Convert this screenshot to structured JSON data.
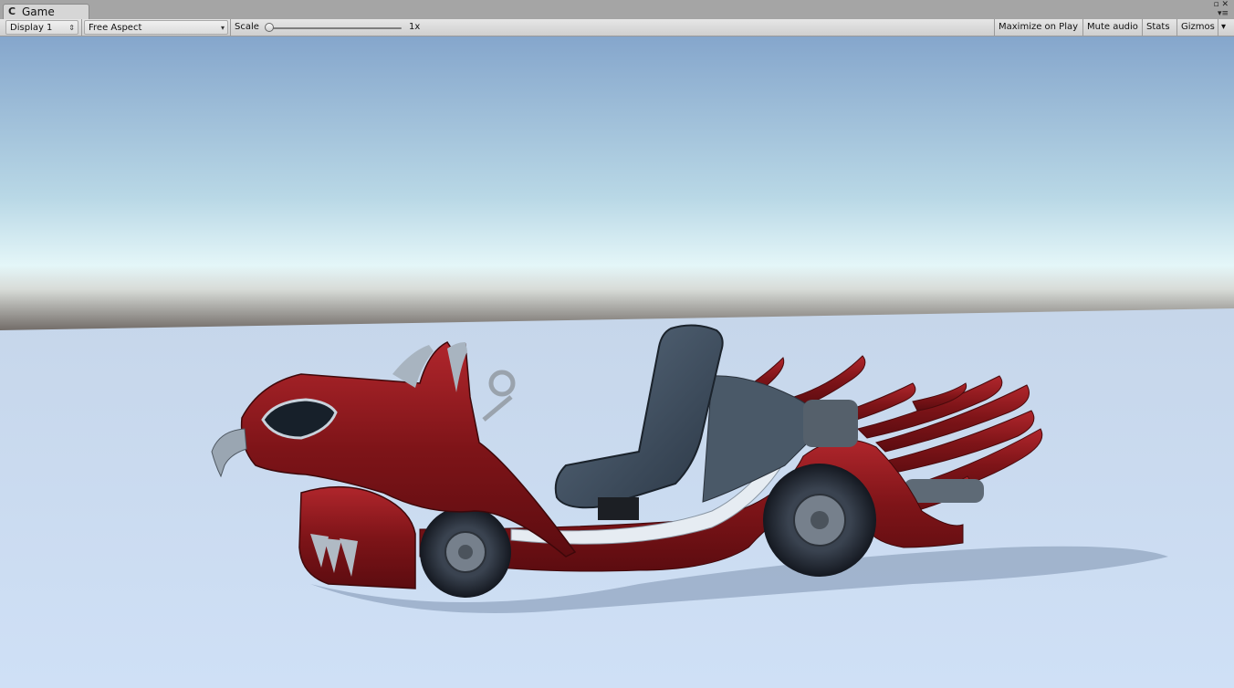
{
  "tab": {
    "label": "Game",
    "icon": "pacman-game-icon"
  },
  "toolbar": {
    "display": "Display 1",
    "aspect": "Free Aspect",
    "scale_label": "Scale",
    "scale_value": "1x",
    "scale_level": 0.0,
    "maximize": "Maximize on Play",
    "mute": "Mute audio",
    "stats": "Stats",
    "gizmos": "Gizmos"
  },
  "colors": {
    "sky_top": "#86a7cd",
    "sky_horizon": "#e4f6f8",
    "ground": "#c9d9ee",
    "kart_body": "#8e1a1f",
    "seat": "#3c4d5f"
  },
  "scene": {
    "object": "red-eagle-go-kart",
    "icons": [
      "maximize-icon",
      "close-icon",
      "menu-icon",
      "dropdown-arrow-icon"
    ]
  }
}
